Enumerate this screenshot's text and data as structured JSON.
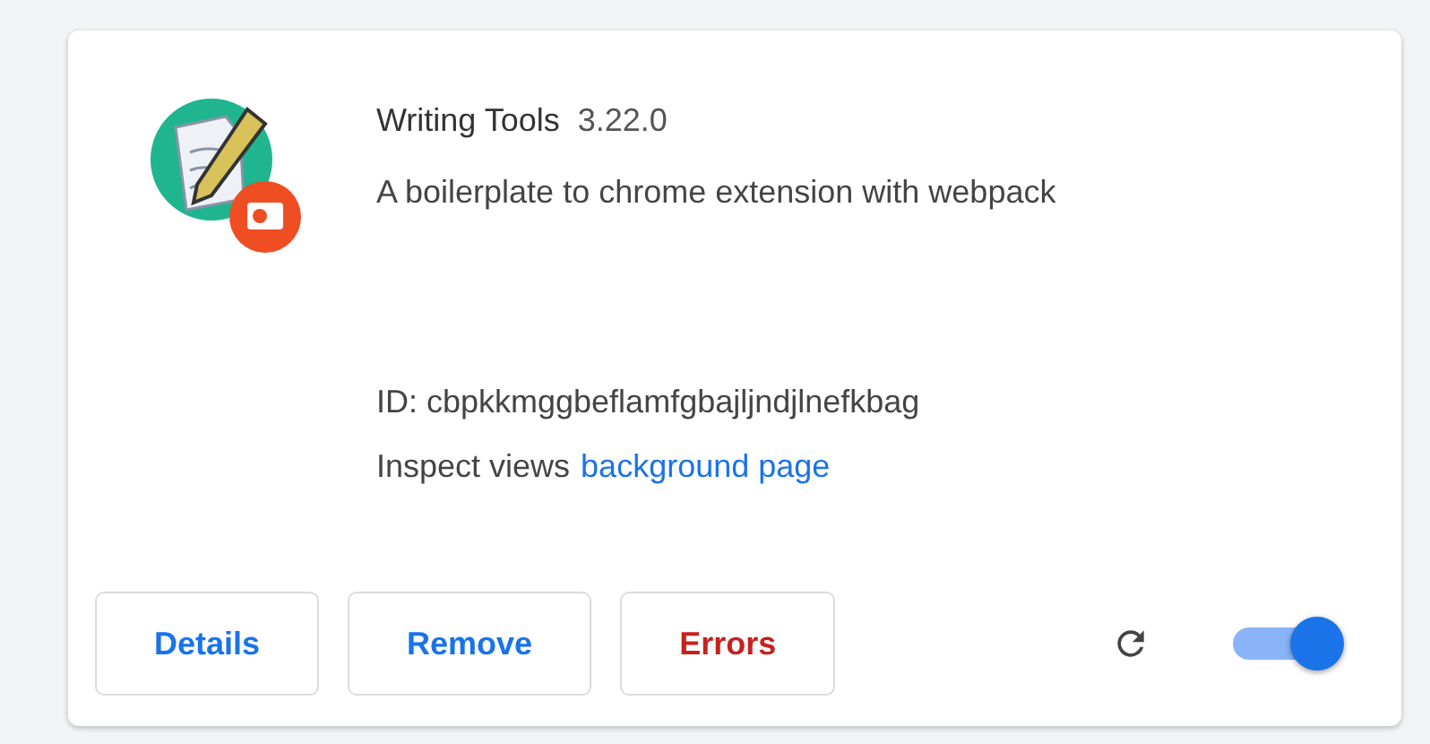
{
  "extension": {
    "name": "Writing Tools",
    "version": "3.22.0",
    "description": "A boilerplate to chrome extension with webpack",
    "id_line": "ID: cbpkkmggbeflamfgbajljndjlnefkbag",
    "inspect_label": "Inspect views",
    "inspect_link": "background page"
  },
  "buttons": [
    {
      "label": "Details",
      "kind": "normal"
    },
    {
      "label": "Remove",
      "kind": "normal"
    },
    {
      "label": "Errors",
      "kind": "error"
    }
  ],
  "toggle": {
    "on": true
  }
}
